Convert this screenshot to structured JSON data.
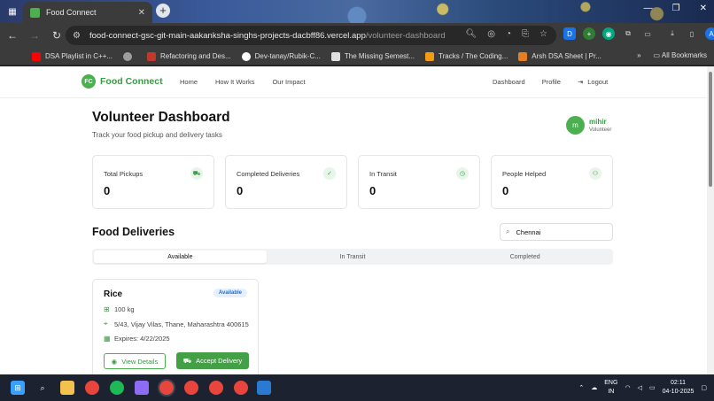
{
  "browser": {
    "tab_title": "Food Connect",
    "url_host": "food-connect-gsc-git-main-aakanksha-singhs-projects-dacbff86.vercel.app",
    "url_path": "/volunteer-dashboard",
    "bookmarks": [
      {
        "label": "DSA Playlist in C++...",
        "color": "#ff0000"
      },
      {
        "label": "",
        "color": "#9e9e9e"
      },
      {
        "label": "Refactoring and Des...",
        "color": "#c0392b"
      },
      {
        "label": "Dev-tanay/Rubik-C...",
        "color": "#ffffff"
      },
      {
        "label": "The Missing Semest...",
        "color": "#e0e0e0"
      },
      {
        "label": "Tracks / The Coding...",
        "color": "#f39c12"
      },
      {
        "label": "Arsh DSA Sheet | Pr...",
        "color": "#e67e22"
      }
    ],
    "all_bookmarks": "All Bookmarks",
    "profile_initial": "A"
  },
  "site": {
    "logo_mark": "FC",
    "logo_name": "Food Connect",
    "nav": [
      "Home",
      "How It Works",
      "Our Impact"
    ],
    "nav_right": [
      "Dashboard",
      "Profile"
    ],
    "logout": "Logout"
  },
  "dashboard": {
    "title": "Volunteer Dashboard",
    "subtitle": "Track your food pickup and delivery tasks",
    "user": {
      "initial": "m",
      "name": "mihir",
      "role": "Volunteer"
    },
    "stats": [
      {
        "label": "Total Pickups",
        "value": "0",
        "icon": "truck-icon"
      },
      {
        "label": "Completed Deliveries",
        "value": "0",
        "icon": "check-circle-icon"
      },
      {
        "label": "In Transit",
        "value": "0",
        "icon": "clock-icon"
      },
      {
        "label": "People Helped",
        "value": "0",
        "icon": "users-icon"
      }
    ]
  },
  "deliveries": {
    "title": "Food Deliveries",
    "search_value": "Chennai",
    "tabs": [
      "Available",
      "In Transit",
      "Completed"
    ],
    "active_tab": "Available",
    "cards": [
      {
        "name": "Rice",
        "status": "Available",
        "quantity": "100 kg",
        "address": "5/43, Vijay Vilas, Thane, Maharashtra 400615",
        "expires": "Expires: 4/22/2025",
        "view_label": "View Details",
        "accept_label": "Accept Delivery"
      }
    ]
  },
  "taskbar": {
    "lang": "ENG",
    "region": "IN",
    "time": "02:11",
    "date": "04-10-2025"
  }
}
